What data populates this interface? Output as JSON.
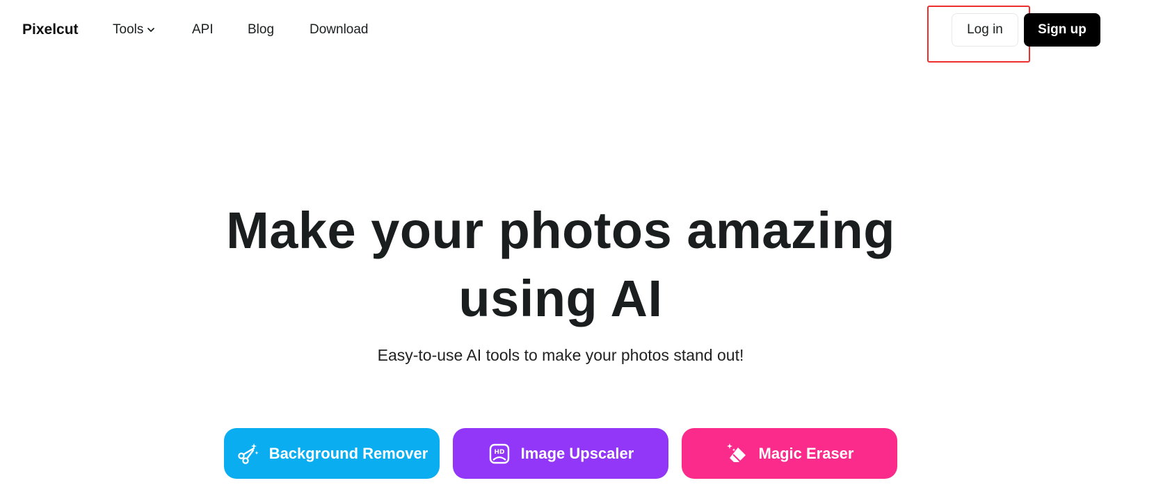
{
  "header": {
    "logo": "Pixelcut",
    "nav": {
      "tools": "Tools",
      "api": "API",
      "blog": "Blog",
      "download": "Download"
    },
    "login_label": "Log in",
    "signup_label": "Sign up"
  },
  "hero": {
    "title_line1": "Make your photos amazing",
    "title_line2": "using AI",
    "subtitle": "Easy-to-use AI tools to make your photos stand out!"
  },
  "tools": [
    {
      "label": "Background Remover",
      "icon": "scissors-sparkle-icon",
      "color": "#0aaef0"
    },
    {
      "label": "Image Upscaler",
      "icon": "hd-image-icon",
      "color": "#9236f7"
    },
    {
      "label": "Magic Eraser",
      "icon": "eraser-sparkle-icon",
      "color": "#fb2b8c"
    }
  ],
  "annotation": {
    "highlight_color": "#ee2d2d"
  }
}
